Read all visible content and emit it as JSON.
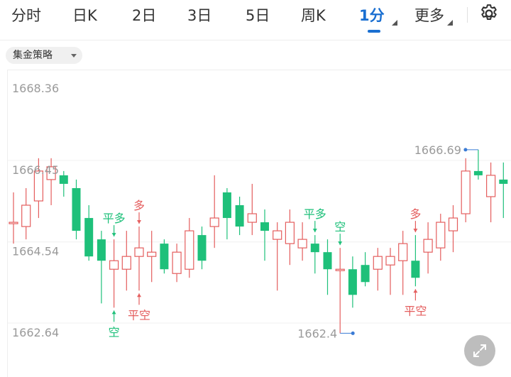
{
  "tabs": [
    {
      "label": "分时"
    },
    {
      "label": "日K"
    },
    {
      "label": "2日"
    },
    {
      "label": "3日"
    },
    {
      "label": "5日"
    },
    {
      "label": "周K"
    },
    {
      "label": "1分"
    },
    {
      "label": "更多"
    }
  ],
  "active_tab": "1分",
  "strategy_label": "集金策略",
  "icons": [
    "settings-gear-icon",
    "dropdown-caret-icon",
    "expand-icon"
  ],
  "colors": {
    "up": "#e45e5e",
    "down": "#1ec07a",
    "accent": "#1a6fd1",
    "marker": "#3a7bd5"
  },
  "chart_data": {
    "type": "candlestick",
    "y_labels": [
      "1668.36",
      "1666.45",
      "1664.54",
      "1662.64"
    ],
    "ylim": [
      1662.64,
      1668.36
    ],
    "max_label": "1666.69",
    "min_label": "1662.4",
    "signals": [
      {
        "text": "平多"
      },
      {
        "text": "空"
      },
      {
        "text": "多"
      },
      {
        "text": "平空"
      },
      {
        "text": "平多"
      },
      {
        "text": "空"
      },
      {
        "text": "多"
      },
      {
        "text": "平空"
      }
    ],
    "candles": [
      {
        "o": 1665.0,
        "h": 1665.7,
        "l": 1664.5,
        "c": 1665.0
      },
      {
        "o": 1664.9,
        "h": 1665.8,
        "l": 1664.6,
        "c": 1665.4
      },
      {
        "o": 1665.5,
        "h": 1666.5,
        "l": 1665.1,
        "c": 1666.2
      },
      {
        "o": 1666.0,
        "h": 1666.5,
        "l": 1665.4,
        "c": 1666.3
      },
      {
        "o": 1666.1,
        "h": 1666.2,
        "l": 1665.6,
        "c": 1665.9
      },
      {
        "o": 1665.8,
        "h": 1666.0,
        "l": 1664.6,
        "c": 1664.8
      },
      {
        "o": 1665.1,
        "h": 1665.4,
        "l": 1664.1,
        "c": 1664.2
      },
      {
        "o": 1664.6,
        "h": 1664.8,
        "l": 1663.1,
        "c": 1664.1
      },
      {
        "o": 1663.9,
        "h": 1664.6,
        "l": 1663.0,
        "c": 1664.1
      },
      {
        "o": 1663.9,
        "h": 1664.8,
        "l": 1663.4,
        "c": 1664.2
      },
      {
        "o": 1664.2,
        "h": 1664.9,
        "l": 1663.4,
        "c": 1664.4
      },
      {
        "o": 1664.2,
        "h": 1664.8,
        "l": 1663.6,
        "c": 1664.3
      },
      {
        "o": 1664.5,
        "h": 1664.6,
        "l": 1663.8,
        "c": 1663.9
      },
      {
        "o": 1663.8,
        "h": 1664.5,
        "l": 1663.6,
        "c": 1664.3
      },
      {
        "o": 1663.9,
        "h": 1665.1,
        "l": 1663.7,
        "c": 1664.8
      },
      {
        "o": 1664.7,
        "h": 1664.9,
        "l": 1663.9,
        "c": 1664.1
      },
      {
        "o": 1664.9,
        "h": 1666.1,
        "l": 1664.4,
        "c": 1665.1
      },
      {
        "o": 1665.7,
        "h": 1665.8,
        "l": 1664.6,
        "c": 1665.1
      },
      {
        "o": 1665.4,
        "h": 1665.6,
        "l": 1664.7,
        "c": 1664.9
      },
      {
        "o": 1665.0,
        "h": 1665.9,
        "l": 1664.7,
        "c": 1665.2
      },
      {
        "o": 1665.0,
        "h": 1665.3,
        "l": 1664.1,
        "c": 1664.8
      },
      {
        "o": 1664.6,
        "h": 1665.0,
        "l": 1663.4,
        "c": 1664.8
      },
      {
        "o": 1664.5,
        "h": 1665.3,
        "l": 1664.0,
        "c": 1665.0
      },
      {
        "o": 1664.4,
        "h": 1665.0,
        "l": 1664.1,
        "c": 1664.6
      },
      {
        "o": 1664.5,
        "h": 1664.7,
        "l": 1663.8,
        "c": 1664.3
      },
      {
        "o": 1664.3,
        "h": 1664.6,
        "l": 1663.3,
        "c": 1663.9
      },
      {
        "o": 1663.9,
        "h": 1664.4,
        "l": 1662.4,
        "c": 1663.9
      },
      {
        "o": 1663.9,
        "h": 1664.2,
        "l": 1663.0,
        "c": 1663.3
      },
      {
        "o": 1664.0,
        "h": 1664.3,
        "l": 1663.5,
        "c": 1663.6
      },
      {
        "o": 1663.9,
        "h": 1664.4,
        "l": 1663.4,
        "c": 1664.2
      },
      {
        "o": 1664.0,
        "h": 1664.4,
        "l": 1663.3,
        "c": 1664.2
      },
      {
        "o": 1664.1,
        "h": 1664.8,
        "l": 1663.3,
        "c": 1664.5
      },
      {
        "o": 1664.1,
        "h": 1664.7,
        "l": 1663.5,
        "c": 1663.7
      },
      {
        "o": 1664.3,
        "h": 1665.0,
        "l": 1663.8,
        "c": 1664.6
      },
      {
        "o": 1664.4,
        "h": 1665.2,
        "l": 1664.1,
        "c": 1665.0
      },
      {
        "o": 1664.8,
        "h": 1665.4,
        "l": 1664.3,
        "c": 1665.1
      },
      {
        "o": 1665.2,
        "h": 1666.5,
        "l": 1665.0,
        "c": 1666.2
      },
      {
        "o": 1666.2,
        "h": 1666.7,
        "l": 1666.0,
        "c": 1666.1
      },
      {
        "o": 1665.6,
        "h": 1666.4,
        "l": 1665.0,
        "c": 1666.1
      },
      {
        "o": 1666.0,
        "h": 1666.4,
        "l": 1665.1,
        "c": 1665.9
      }
    ]
  }
}
